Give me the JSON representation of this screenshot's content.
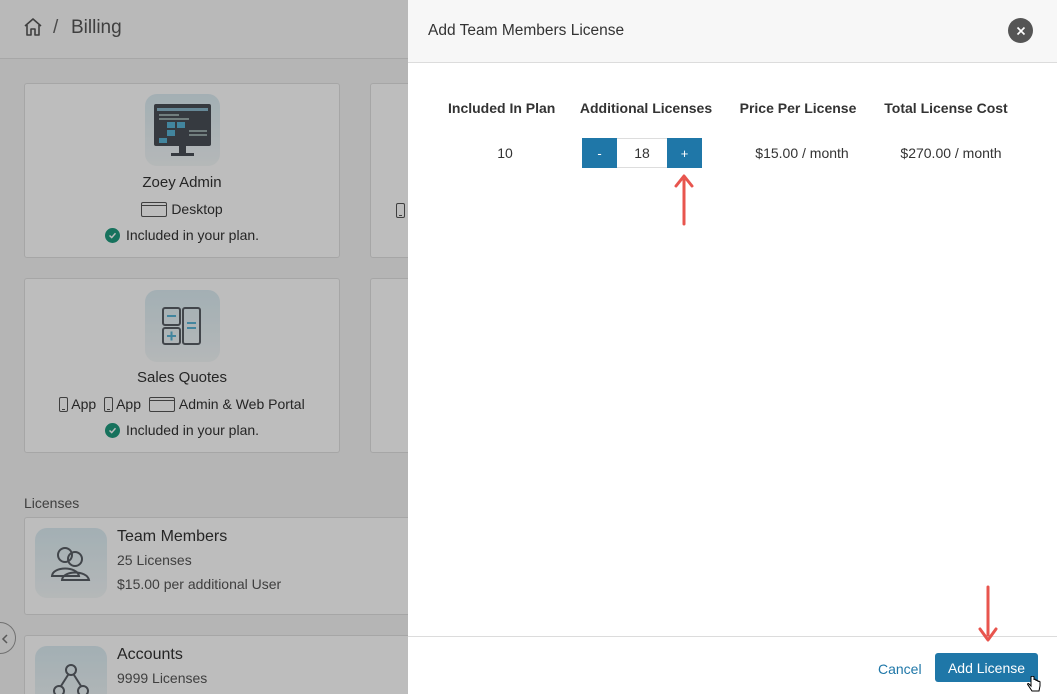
{
  "breadcrumb": {
    "separator": "/",
    "current": "Billing"
  },
  "app_cards": [
    {
      "title": "Zoey Admin",
      "platforms": [
        "Desktop"
      ],
      "status": "Included in your plan."
    },
    {
      "title": "Sales Quotes",
      "platforms": [
        "App",
        "App",
        "Admin & Web Portal"
      ],
      "status": "Included in your plan."
    }
  ],
  "licenses_section": {
    "label": "Licenses",
    "items": [
      {
        "title": "Team Members",
        "count": "25 Licenses",
        "price": "$15.00 per additional User"
      },
      {
        "title": "Accounts",
        "count": "9999 Licenses"
      }
    ]
  },
  "modal": {
    "title": "Add Team Members License",
    "columns": [
      "Included In Plan",
      "Additional Licenses",
      "Price Per License",
      "Total License Cost"
    ],
    "included_in_plan": "10",
    "stepper": {
      "minus": "-",
      "value": "18",
      "plus": "+"
    },
    "price_per_license": "$15.00 / month",
    "total_cost": "$270.00 / month",
    "cancel_label": "Cancel",
    "submit_label": "Add License"
  },
  "colors": {
    "accent": "#1f77a8",
    "check": "#1f9a7e",
    "annotation_arrow": "#e8554e"
  }
}
